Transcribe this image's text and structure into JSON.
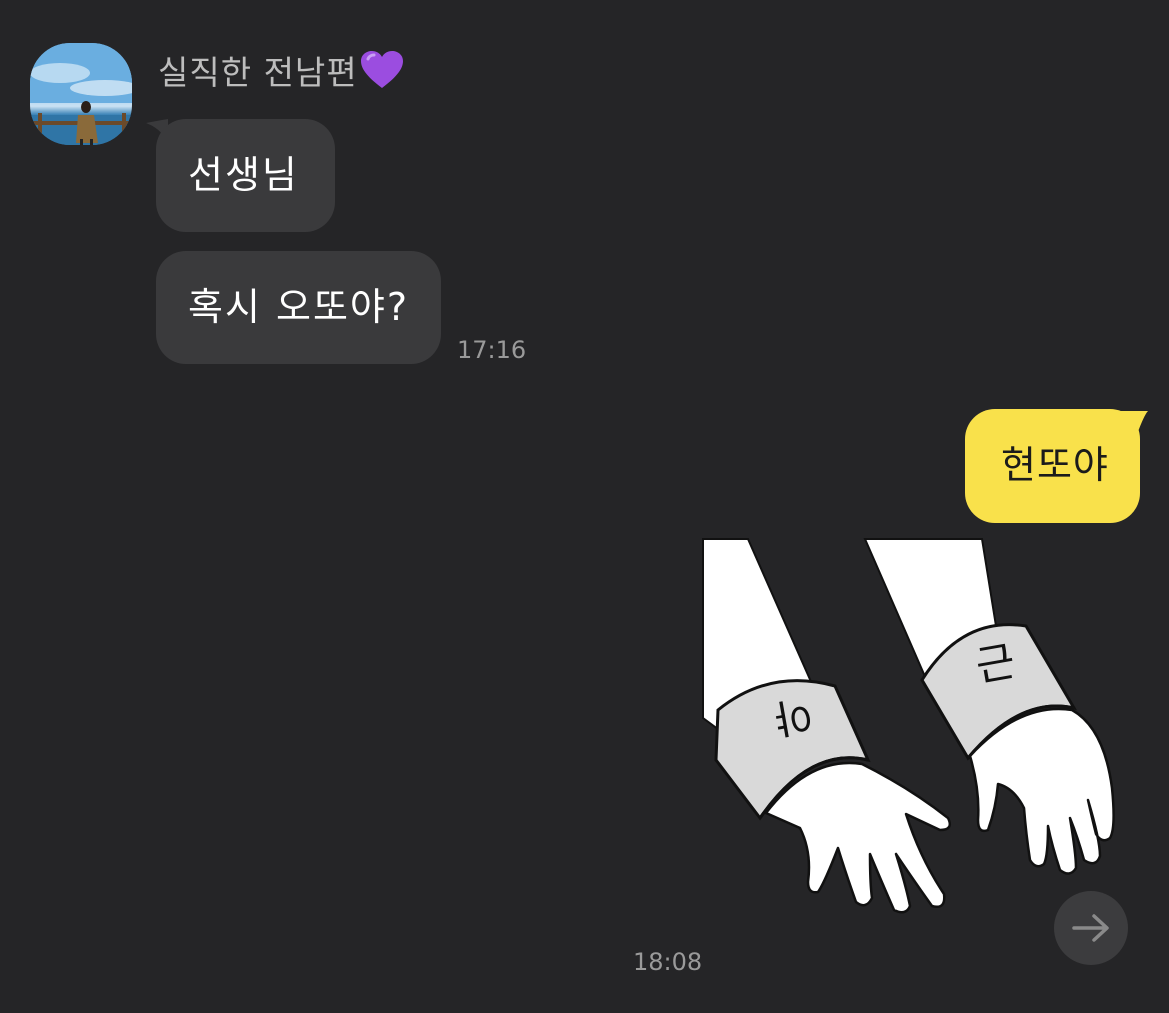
{
  "chat": {
    "sender": {
      "name": "실직한 전남편",
      "name_emoji": "purple-heart",
      "avatar": "profile-photo"
    },
    "incoming_messages": [
      {
        "text": "선생님"
      },
      {
        "text": "혹시 오또야?"
      }
    ],
    "incoming_time": "17:16",
    "outgoing_message": {
      "text": "현또야"
    },
    "sticker": {
      "description": "two-hands-sticker",
      "cuff_labels": [
        "야",
        "근"
      ]
    },
    "sticker_time": "18:08"
  },
  "controls": {
    "scroll_button_icon": "arrow-right-icon"
  },
  "colors": {
    "background": "#252527",
    "incoming_bubble": "#3a3a3c",
    "outgoing_bubble": "#f9e14b",
    "timestamp": "#9a9a9a",
    "sender_name": "#bdbdbd",
    "heart": "#9b4de0"
  }
}
